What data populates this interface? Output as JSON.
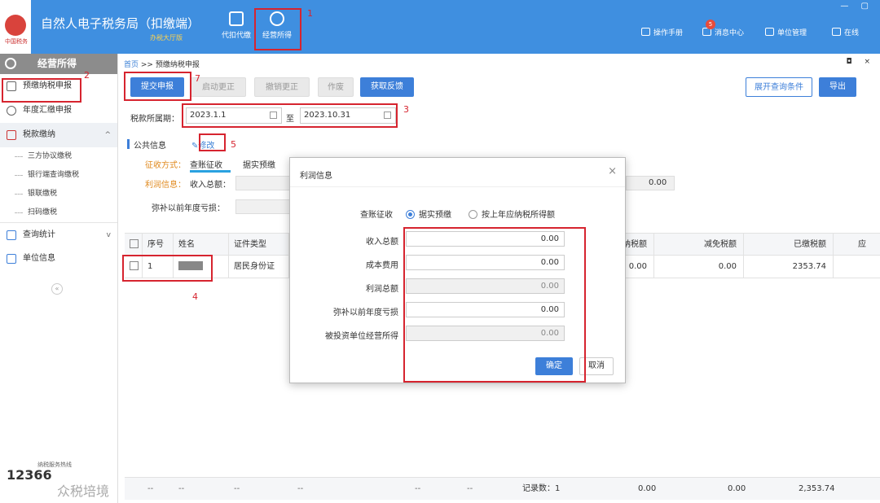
{
  "app": {
    "title": "自然人电子税务局（扣缴端）",
    "subtitle": "办税大厅版",
    "logo_text": "中国税务"
  },
  "top_nav": [
    {
      "label": "代扣代缴",
      "icon": "wallet-icon"
    },
    {
      "label": "经营所得",
      "icon": "coins-icon"
    }
  ],
  "window_controls": "— ▢",
  "top_right": {
    "manual": "操作手册",
    "messages": "消息中心",
    "message_count": "5",
    "unit": "单位管理",
    "online": "在线"
  },
  "sidebar": {
    "header": "经营所得",
    "items": [
      {
        "label": "预缴纳税申报",
        "icon": "document-icon"
      },
      {
        "label": "年度汇缴申报",
        "icon": "yen-icon"
      },
      {
        "label": "税款缴纳",
        "icon": "tax-icon",
        "chevron": "^"
      },
      {
        "label": "三方协议缴税"
      },
      {
        "label": "银行端查询缴税"
      },
      {
        "label": "银联缴税"
      },
      {
        "label": "扫码缴税"
      },
      {
        "label": "查询统计",
        "icon": "chart-icon",
        "chevron": "v"
      },
      {
        "label": "单位信息",
        "icon": "list-icon"
      }
    ],
    "collapse": "«",
    "hotline_label": "纳税服务热线",
    "hotline": "12366"
  },
  "breadcrumb": {
    "home": "首页",
    "sep": ">>",
    "current": "预缴纳税申报",
    "controls": "◘ ×"
  },
  "toolbar": {
    "submit": "提交申报",
    "start_correction": "启动更正",
    "cancel_correction": "撤销更正",
    "void": "作废",
    "get_feedback": "获取反馈",
    "expand_query": "展开查询条件",
    "export": "导出"
  },
  "period": {
    "label": "税款所属期：",
    "start": "2023.1.1",
    "to": "至",
    "end": "2023.10.31"
  },
  "public_info": {
    "title": "公共信息",
    "edit": "修改",
    "mode_label": "征收方式：",
    "mode_value": "查账征收",
    "mode_other": "据实预缴",
    "profit_label": "利润信息：",
    "income_label": "收入总额：",
    "loss_label": "弥补以前年度亏损：",
    "behind_value": "0.00"
  },
  "table": {
    "headers": [
      "序号",
      "姓名",
      "证件类型",
      "纳税额",
      "减免税额",
      "已缴税额",
      "应"
    ],
    "rows": [
      {
        "no": "1",
        "id_type": "居民身份证",
        "tax": "0.00",
        "relief": "0.00",
        "paid": "2353.74"
      }
    ],
    "footer": {
      "dash": "--",
      "count": "记录数：1",
      "tax": "0.00",
      "relief": "0.00",
      "paid": "2,353.74"
    }
  },
  "modal": {
    "title": "利润信息",
    "close": "×",
    "radio_label": "查账征收",
    "radio1": "据实预缴",
    "radio2": "按上年应纳税所得额",
    "fields": [
      {
        "label": "收入总额",
        "value": "0.00"
      },
      {
        "label": "成本费用",
        "value": "0.00"
      },
      {
        "label": "利润总额",
        "value": "0.00"
      },
      {
        "label": "弥补以前年度亏损",
        "value": "0.00"
      },
      {
        "label": "被投资单位经营所得",
        "value": "0.00"
      }
    ],
    "ok": "确定",
    "cancel": "取消"
  },
  "annotations": [
    "1",
    "2",
    "3",
    "4",
    "5",
    "7"
  ],
  "watermark": "众税培境",
  "colors": {
    "primary": "#3d7fd9",
    "header": "#3f8fe0",
    "annotation": "#d6242f"
  }
}
